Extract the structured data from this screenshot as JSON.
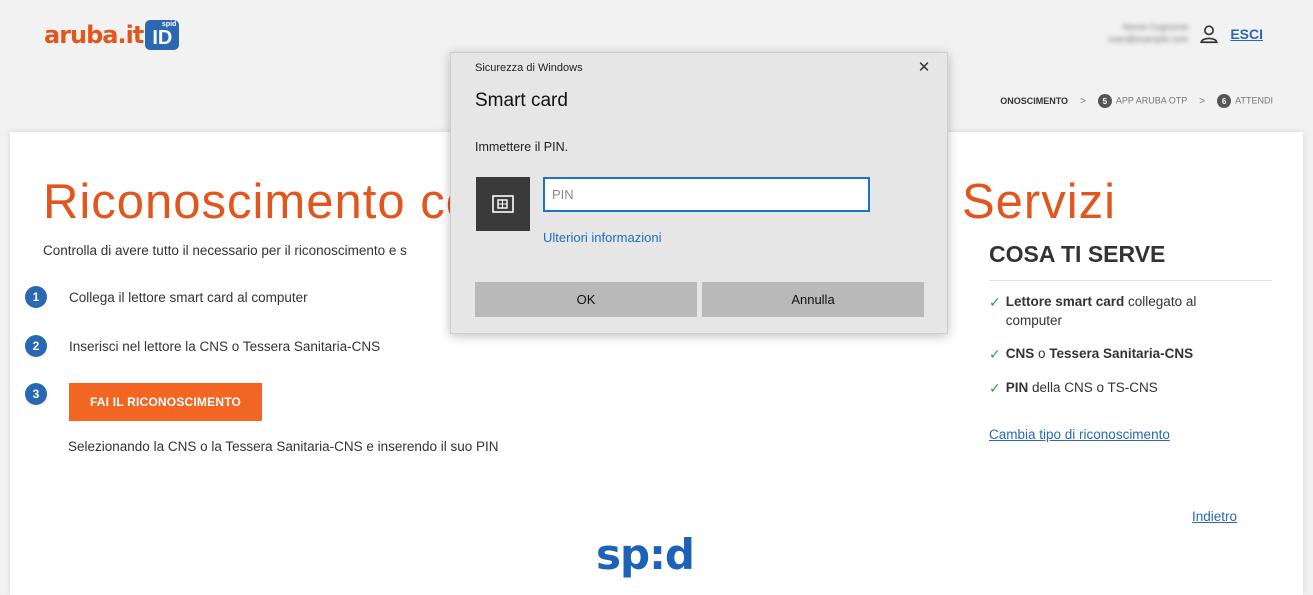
{
  "header": {
    "logo_text": "aruba.it",
    "logo_badge": "ID",
    "logo_badge_small": "spid",
    "user_line1": "Nome Cognome",
    "user_line2": "user@example.com",
    "logout_label": "ESCI"
  },
  "steps": {
    "current_label": "ONOSCIMENTO",
    "items": [
      {
        "num": "5",
        "label": "APP ARUBA OTP"
      },
      {
        "num": "6",
        "label": "ATTENDI"
      }
    ],
    "separator": ">"
  },
  "main": {
    "title": "Riconoscimento co",
    "subtitle": "Controlla di avere tutto il necessario per il riconoscimento e s",
    "steps": [
      {
        "num": "1",
        "text": "Collega il lettore smart card al computer"
      },
      {
        "num": "2",
        "text": "Inserisci nel lettore la CNS o Tessera Sanitaria-CNS"
      },
      {
        "num": "3"
      }
    ],
    "cta_label": "FAI IL RICONOSCIMENTO",
    "cta_note": "Selezionando la CNS o la Tessera Sanitaria-CNS e inserendo il suo PIN"
  },
  "side": {
    "title": "Servizi",
    "serve_title": "COSA TI SERVE",
    "requirements": [
      {
        "bold": "Lettore smart card",
        "rest": " collegato al computer"
      },
      {
        "bold": "CNS",
        "mid": " o ",
        "bold2": "Tessera Sanitaria-CNS"
      },
      {
        "bold": "PIN",
        "rest": " della CNS o TS-CNS"
      }
    ],
    "change_link": "Cambia tipo di riconoscimento",
    "back_link": "Indietro"
  },
  "footer": {
    "spid_logo": "sp:d"
  },
  "dialog": {
    "caption": "Sicurezza di Windows",
    "close_glyph": "✕",
    "title": "Smart card",
    "prompt": "Immettere il PIN.",
    "pin_placeholder": "PIN",
    "more_info": "Ulteriori informazioni",
    "ok_label": "OK",
    "cancel_label": "Annulla"
  },
  "colors": {
    "accent_orange": "#e2561e",
    "button_orange": "#f26522",
    "brand_blue": "#2a68b3",
    "check_green": "#2e9e44",
    "input_focus": "#1b73c9"
  }
}
